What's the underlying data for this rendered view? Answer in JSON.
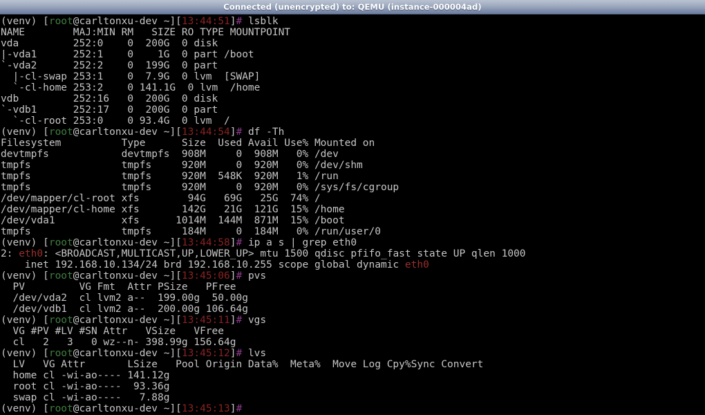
{
  "window": {
    "title": "Connected (unencrypted) to: QEMU (instance-000004ad)"
  },
  "colors": {
    "background": "#000000",
    "foreground": "#c6c6c6",
    "prompt_user": "#3f7f3f",
    "prompt_time": "#8b2222",
    "prompt_sigil": "#8b3a8b",
    "grep_match": "#9b2d2d",
    "titlebar_text": "#ffffff"
  },
  "terminal": {
    "prompt": {
      "venv": "(venv) ",
      "bracket_open": "[",
      "user": "root",
      "at_host": "@carltonxu-dev ~]",
      "time_open": "[",
      "time_close": "]",
      "sigil": "#"
    },
    "lines": [
      {
        "type": "prompt",
        "time": "13:44:51",
        "command": " lsblk"
      },
      {
        "type": "out",
        "text": "NAME        MAJ:MIN RM   SIZE RO TYPE MOUNTPOINT"
      },
      {
        "type": "out",
        "text": "vda         252:0    0  200G  0 disk "
      },
      {
        "type": "out",
        "text": "|-vda1      252:1    0    1G  0 part /boot"
      },
      {
        "type": "out",
        "text": "`-vda2      252:2    0  199G  0 part "
      },
      {
        "type": "out",
        "text": "  |-cl-swap 253:1    0  7.9G  0 lvm  [SWAP]"
      },
      {
        "type": "out",
        "text": "  `-cl-home 253:2    0 141.1G  0 lvm  /home"
      },
      {
        "type": "out",
        "text": "vdb         252:16   0  200G  0 disk "
      },
      {
        "type": "out",
        "text": "`-vdb1      252:17   0  200G  0 part "
      },
      {
        "type": "out",
        "text": "  `-cl-root 253:0    0 93.4G  0 lvm  /"
      },
      {
        "type": "prompt",
        "time": "13:44:54",
        "command": " df -Th"
      },
      {
        "type": "out",
        "text": "Filesystem          Type      Size  Used Avail Use% Mounted on"
      },
      {
        "type": "out",
        "text": "devtmpfs            devtmpfs  908M     0  908M   0% /dev"
      },
      {
        "type": "out",
        "text": "tmpfs               tmpfs     920M     0  920M   0% /dev/shm"
      },
      {
        "type": "out",
        "text": "tmpfs               tmpfs     920M  548K  920M   1% /run"
      },
      {
        "type": "out",
        "text": "tmpfs               tmpfs     920M     0  920M   0% /sys/fs/cgroup"
      },
      {
        "type": "out",
        "text": "/dev/mapper/cl-root xfs        94G   69G   25G  74% /"
      },
      {
        "type": "out",
        "text": "/dev/mapper/cl-home xfs       142G   21G  121G  15% /home"
      },
      {
        "type": "out",
        "text": "/dev/vda1           xfs      1014M  144M  871M  15% /boot"
      },
      {
        "type": "out",
        "text": "tmpfs               tmpfs     184M     0  184M   0% /run/user/0"
      },
      {
        "type": "prompt",
        "time": "13:44:58",
        "command": " ip a s | grep eth0"
      },
      {
        "type": "grep",
        "pre": "2: ",
        "match": "eth0",
        "post": ": <BROADCAST,MULTICAST,UP,LOWER_UP> mtu 1500 qdisc pfifo_fast state UP qlen 1000"
      },
      {
        "type": "grep",
        "pre": "    inet 192.168.10.134/24 brd 192.168.10.255 scope global dynamic ",
        "match": "eth0",
        "post": ""
      },
      {
        "type": "prompt",
        "time": "13:45:06",
        "command": " pvs"
      },
      {
        "type": "out",
        "text": "  PV         VG Fmt  Attr PSize   PFree  "
      },
      {
        "type": "out",
        "text": "  /dev/vda2  cl lvm2 a--  199.00g  50.00g"
      },
      {
        "type": "out",
        "text": "  /dev/vdb1  cl lvm2 a--  200.00g 106.64g"
      },
      {
        "type": "prompt",
        "time": "13:45:11",
        "command": " vgs"
      },
      {
        "type": "out",
        "text": "  VG #PV #LV #SN Attr   VSize   VFree  "
      },
      {
        "type": "out",
        "text": "  cl   2   3   0 wz--n- 398.99g 156.64g"
      },
      {
        "type": "prompt",
        "time": "13:45:12",
        "command": " lvs"
      },
      {
        "type": "out",
        "text": "  LV   VG Attr       LSize   Pool Origin Data%  Meta%  Move Log Cpy%Sync Convert"
      },
      {
        "type": "out",
        "text": "  home cl -wi-ao---- 141.12g"
      },
      {
        "type": "out",
        "text": "  root cl -wi-ao----  93.36g"
      },
      {
        "type": "out",
        "text": "  swap cl -wi-ao----   7.88g"
      },
      {
        "type": "prompt",
        "time": "13:45:13",
        "command": ""
      }
    ]
  }
}
